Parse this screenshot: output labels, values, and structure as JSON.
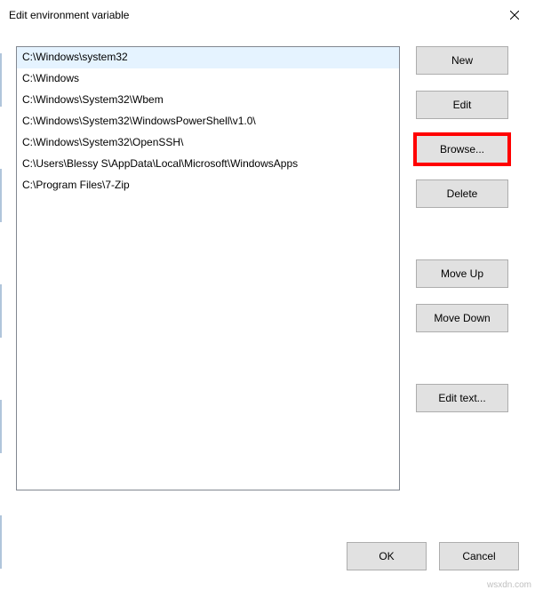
{
  "title": "Edit environment variable",
  "paths": [
    "C:\\Windows\\system32",
    "C:\\Windows",
    "C:\\Windows\\System32\\Wbem",
    "C:\\Windows\\System32\\WindowsPowerShell\\v1.0\\",
    "C:\\Windows\\System32\\OpenSSH\\",
    "C:\\Users\\Blessy S\\AppData\\Local\\Microsoft\\WindowsApps",
    "C:\\Program Files\\7-Zip"
  ],
  "selected_index": 0,
  "buttons": {
    "new": "New",
    "edit": "Edit",
    "browse": "Browse...",
    "delete": "Delete",
    "move_up": "Move Up",
    "move_down": "Move Down",
    "edit_text": "Edit text...",
    "ok": "OK",
    "cancel": "Cancel"
  },
  "watermark": "wsxdn.com"
}
